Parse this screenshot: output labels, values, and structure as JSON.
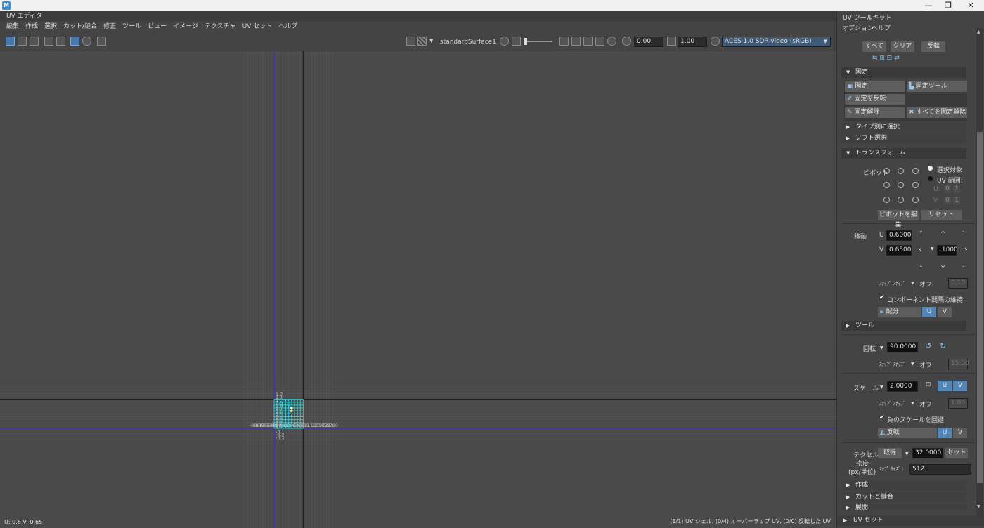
{
  "window": {
    "logo": "M",
    "minimize": "—",
    "maximize": "❐",
    "close": "✕"
  },
  "uv_editor": {
    "title": "UV エディタ",
    "menu": [
      "編集",
      "作成",
      "選択",
      "カット/縫合",
      "修正",
      "ツール",
      "ビュー",
      "イメージ",
      "テクスチャ",
      "UV セット",
      "ヘルプ"
    ],
    "toolbar": {
      "material": "standardSurface1",
      "exposure": "0.00",
      "gamma": "1.00",
      "colorspace": "ACES 1.0 SDR-video (sRGB)"
    },
    "grid": {
      "x_labels": [
        "-0.9",
        "-0.8",
        "-0.7",
        "-0.6",
        "-0.5",
        "-0.4",
        "-0.3",
        "-0.2",
        "-0.1",
        "0",
        "0.1",
        "0.2",
        "0.3",
        "0.4",
        "0.5",
        "0.6",
        "0.7",
        "0.8",
        "0.9",
        "1",
        "1.1",
        "1.2",
        "1.3",
        "1.4",
        "1.5",
        "1.6",
        "1.7",
        "1.8",
        "1.9"
      ],
      "y_labels": [
        "1.2",
        "1.1",
        "1",
        "0.9",
        "0.8",
        "0.7",
        "0.6",
        "0.5",
        "0.4",
        "0.3",
        "0.2",
        "0.1",
        "-0.1",
        "-0.2",
        "-0.3"
      ]
    },
    "status_left": "U: 0.6 V: 0.65",
    "status_right": "(1/1) UV シェル, (0/4) オーバーラップ UV, (0/0) 反転した UV"
  },
  "toolkit": {
    "title": "UV ツールキット",
    "menu": [
      "オプション",
      "ヘルプ"
    ],
    "select_buttons": [
      "すべて",
      "クリア",
      "反転"
    ],
    "pin": {
      "header": "固定",
      "pin": "固定",
      "pin_tool": "固定ツール",
      "invert_pin": "固定を反転",
      "unpin": "固定解除",
      "unpin_all": "すべてを固定解除"
    },
    "select_by_type": "タイプ別に選択",
    "soft_select": "ソフト選択",
    "transform": {
      "header": "トランスフォーム",
      "pivot_label": "ピボット",
      "selection": "選択対象",
      "uv_range": "UV 範囲:",
      "u_label": "U:",
      "v_label": "V:",
      "range_u0": "0",
      "range_u1": "1",
      "range_v0": "0",
      "range_v1": "1",
      "edit_pivot": "ピボットを編集",
      "reset": "リセット",
      "move_label": "移動",
      "move_u": "0.6000",
      "move_v": "0.6500",
      "step": ".1000",
      "snap_label": "ｽﾅｯﾌﾟ ｽﾅｯﾌﾟ",
      "snap_off": "オフ",
      "snap_value": "0.10",
      "keep_spacing": "コンポーネント間隔の維持",
      "distribute": "配分",
      "u": "U",
      "v": "V"
    },
    "tools_header": "ツール",
    "rotate": {
      "label": "回転",
      "value": "90.0000",
      "snap_off": "オフ",
      "snap_value": "15.00"
    },
    "scale": {
      "label": "スケール",
      "value": "2.0000",
      "snap_off": "オフ",
      "snap_value": "1.00",
      "avoid_negative": "負のスケールを回避",
      "flip": "反転"
    },
    "texel": {
      "label1": "テクセル",
      "label2": "密度",
      "label3": "(px/単位)",
      "get": "取得",
      "value": "32.0000",
      "set": "セット",
      "map_size_label": "ﾏｯﾌﾟ ｻｲｽﾞ :",
      "map_size": "512"
    },
    "sections": [
      "作成",
      "カットと縫合",
      "展開",
      "UV セット"
    ]
  },
  "colors": {
    "uv_line": "#33c9d1",
    "axis_blue": "#3a36b8",
    "vertex": "#f0f0a0"
  }
}
